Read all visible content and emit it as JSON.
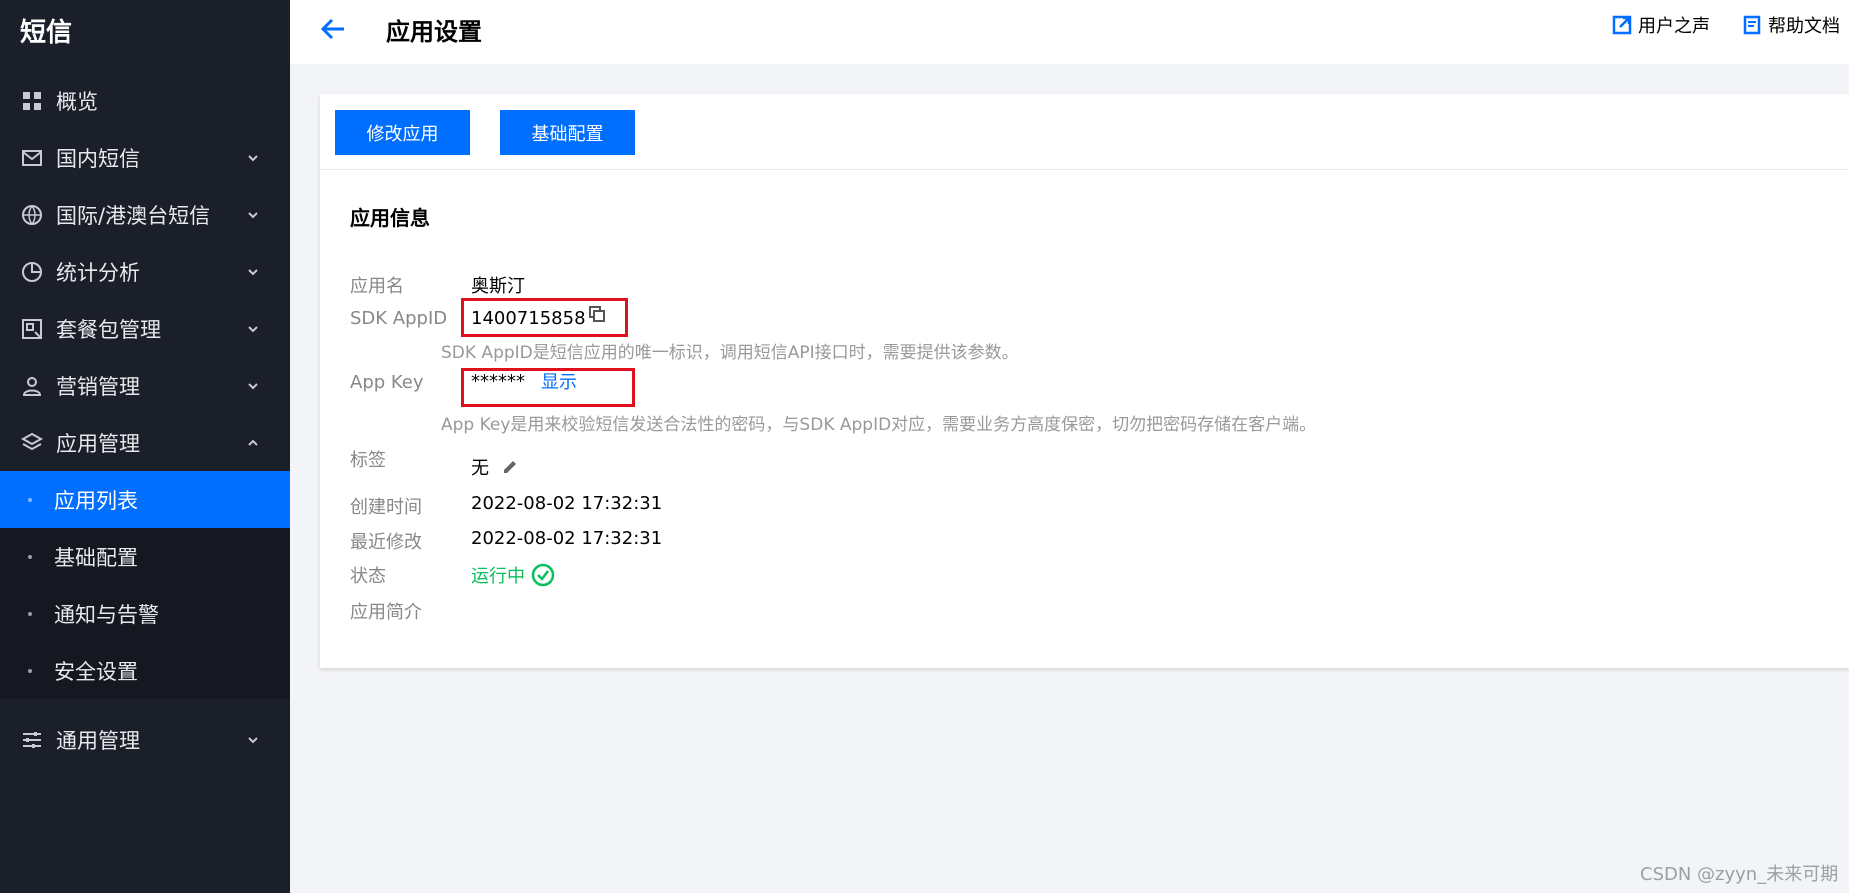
{
  "sidebar": {
    "title": "短信",
    "items": [
      {
        "label": "概览"
      },
      {
        "label": "国内短信"
      },
      {
        "label": "国际/港澳台短信"
      },
      {
        "label": "统计分析"
      },
      {
        "label": "套餐包管理"
      },
      {
        "label": "营销管理"
      },
      {
        "label": "应用管理"
      }
    ],
    "app_sub": [
      {
        "label": "应用列表"
      },
      {
        "label": "基础配置"
      },
      {
        "label": "通知与告警"
      },
      {
        "label": "安全设置"
      }
    ],
    "general": {
      "label": "通用管理"
    }
  },
  "header": {
    "title": "应用设置",
    "voice_label": "用户之声",
    "help_label": "帮助文档"
  },
  "toolbar": {
    "edit_label": "修改应用",
    "base_label": "基础配置"
  },
  "info": {
    "section_title": "应用信息",
    "name_label": "应用名",
    "name_value": "奥斯汀",
    "appid_label": "SDK AppID",
    "appid_value": "1400715858",
    "appid_hint": "SDK AppID是短信应用的唯一标识，调用短信API接口时，需要提供该参数。",
    "appkey_label": "App Key",
    "appkey_value": "******",
    "appkey_show": "显示",
    "appkey_hint": "App Key是用来校验短信发送合法性的密码，与SDK AppID对应，需要业务方高度保密，切勿把密码存储在客户端。",
    "tag_label": "标签",
    "tag_value": "无",
    "created_label": "创建时间",
    "created_value": "2022-08-02 17:32:31",
    "modified_label": "最近修改",
    "modified_value": "2022-08-02 17:32:31",
    "status_label": "状态",
    "status_value": "运行中",
    "intro_label": "应用简介"
  },
  "watermark": "CSDN @zyyn_未来可期",
  "colors": {
    "sidebar_bg": "#1b1f29",
    "accent": "#006eff",
    "status_ok": "#0abf5b",
    "highlight": "#e0101f"
  }
}
